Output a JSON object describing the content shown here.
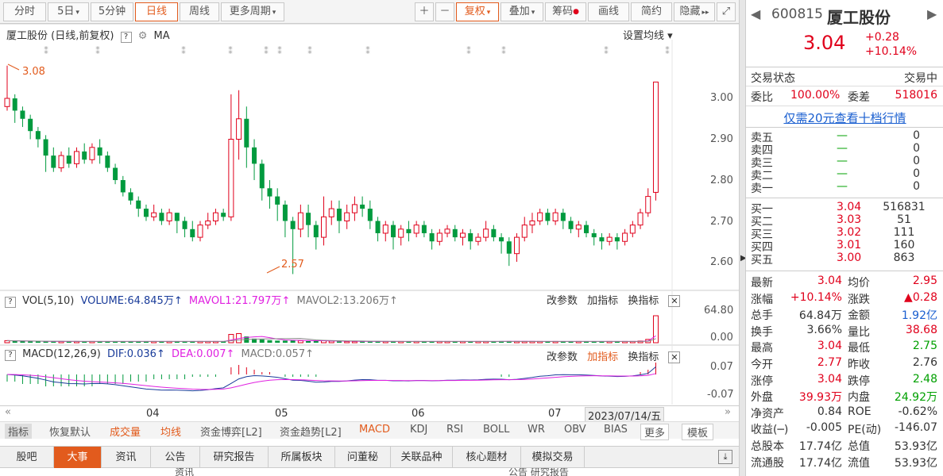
{
  "toolbar": {
    "buttons": [
      "分时",
      "5日",
      "5分钟",
      "日线",
      "周线",
      "更多周期"
    ],
    "active": "日线",
    "right_buttons": [
      "复权",
      "叠加",
      "筹码",
      "画线",
      "简约",
      "隐藏"
    ]
  },
  "chart": {
    "title": "厦工股份 (日线,前复权)",
    "ma_label": "MA",
    "set_ma": "设置均线",
    "high_label": "3.08",
    "low_label": "2.57",
    "y_ticks": [
      "3.00",
      "2.90",
      "2.80",
      "2.70",
      "2.60"
    ],
    "x_ticks": [
      "04",
      "05",
      "06",
      "07"
    ],
    "date_label": "2023/07/14/五"
  },
  "vol": {
    "label": "VOL(5,10)",
    "volume": "VOLUME:64.845万",
    "mavol1": "MAVOL1:21.797万",
    "mavol2": "MAVOL2:13.206万",
    "y_top": "64.80",
    "y_bottom": "0.00",
    "actions": [
      "改参数",
      "加指标",
      "换指标"
    ]
  },
  "macd": {
    "label": "MACD(12,26,9)",
    "dif": "DIF:0.036",
    "dea": "DEA:0.007",
    "macd": "MACD:0.057",
    "y_top": "0.07",
    "y_bottom": "-0.07",
    "actions": [
      "改参数",
      "加指标",
      "换指标"
    ]
  },
  "indicators": [
    "指标",
    "恢复默认",
    "成交量",
    "均线",
    "资金博弈[L2]",
    "资金趋势[L2]",
    "MACD",
    "KDJ",
    "RSI",
    "BOLL",
    "WR",
    "OBV",
    "BIAS",
    "更多",
    "模板"
  ],
  "tabs": [
    "股吧",
    "大事",
    "资讯",
    "公告",
    "研究报告",
    "所属板块",
    "问董秘",
    "关联品种",
    "核心题材",
    "模拟交易"
  ],
  "active_tab": "大事",
  "bottom_stub": {
    "left": "资讯",
    "right": "公告 研究报告"
  },
  "quote": {
    "code": "600815",
    "name": "厦工股份",
    "price": "3.04",
    "change": "+0.28",
    "pct": "+10.14%",
    "status_label": "交易状态",
    "status": "交易中",
    "weibi_label": "委比",
    "weibi": "100.00%",
    "weicha_label": "委差",
    "weicha": "518016",
    "promo": "仅需20元查看十档行情",
    "asks": [
      {
        "label": "卖五",
        "price": "—",
        "vol": "0"
      },
      {
        "label": "卖四",
        "price": "—",
        "vol": "0"
      },
      {
        "label": "卖三",
        "price": "—",
        "vol": "0"
      },
      {
        "label": "卖二",
        "price": "—",
        "vol": "0"
      },
      {
        "label": "卖一",
        "price": "—",
        "vol": "0"
      }
    ],
    "bids": [
      {
        "label": "买一",
        "price": "3.04",
        "vol": "516831"
      },
      {
        "label": "买二",
        "price": "3.03",
        "vol": "51"
      },
      {
        "label": "买三",
        "price": "3.02",
        "vol": "111"
      },
      {
        "label": "买四",
        "price": "3.01",
        "vol": "160"
      },
      {
        "label": "买五",
        "price": "3.00",
        "vol": "863"
      }
    ],
    "stats": [
      {
        "l1": "最新",
        "v1": "3.04",
        "c1": "red",
        "l2": "均价",
        "v2": "2.95",
        "c2": "red"
      },
      {
        "l1": "涨幅",
        "v1": "+10.14%",
        "c1": "red",
        "l2": "涨跌",
        "v2": "▲0.28",
        "c2": "red"
      },
      {
        "l1": "总手",
        "v1": "64.84万",
        "c1": "",
        "l2": "金额",
        "v2": "1.92亿",
        "c2": "blue"
      },
      {
        "l1": "换手",
        "v1": "3.66%",
        "c1": "",
        "l2": "量比",
        "v2": "38.68",
        "c2": "red"
      },
      {
        "l1": "最高",
        "v1": "3.04",
        "c1": "red",
        "l2": "最低",
        "v2": "2.75",
        "c2": "green"
      },
      {
        "l1": "今开",
        "v1": "2.77",
        "c1": "red",
        "l2": "昨收",
        "v2": "2.76",
        "c2": ""
      },
      {
        "l1": "涨停",
        "v1": "3.04",
        "c1": "red",
        "l2": "跌停",
        "v2": "2.48",
        "c2": "green"
      },
      {
        "l1": "外盘",
        "v1": "39.93万",
        "c1": "red",
        "l2": "内盘",
        "v2": "24.92万",
        "c2": "green"
      },
      {
        "l1": "净资产",
        "v1": "0.84",
        "c1": "",
        "l2": "ROE",
        "v2": "-0.62%",
        "c2": ""
      },
      {
        "l1": "收益(─)",
        "v1": "-0.005",
        "c1": "",
        "l2": "PE(动)",
        "v2": "-146.07",
        "c2": ""
      },
      {
        "l1": "总股本",
        "v1": "17.74亿",
        "c1": "",
        "l2": "总值",
        "v2": "53.93亿",
        "c2": ""
      },
      {
        "l1": "流通股",
        "v1": "17.74亿",
        "c1": "",
        "l2": "流值",
        "v2": "53.93亿",
        "c2": ""
      }
    ]
  },
  "colors": {
    "up": "#e0001b",
    "down": "#009a3e",
    "accent": "#e25b1d",
    "ma1": "#e020e0",
    "ma2": "#888888"
  },
  "candles": [
    [
      2.98,
      3.0,
      2.97,
      3.08
    ],
    [
      3.0,
      2.97,
      2.94,
      3.01
    ],
    [
      2.97,
      2.95,
      2.93,
      2.98
    ],
    [
      2.95,
      2.92,
      2.9,
      2.96
    ],
    [
      2.92,
      2.9,
      2.88,
      2.93
    ],
    [
      2.9,
      2.86,
      2.82,
      2.91
    ],
    [
      2.86,
      2.83,
      2.82,
      2.88
    ],
    [
      2.83,
      2.86,
      2.82,
      2.87
    ],
    [
      2.86,
      2.84,
      2.83,
      2.88
    ],
    [
      2.84,
      2.87,
      2.83,
      2.88
    ],
    [
      2.87,
      2.85,
      2.84,
      2.89
    ],
    [
      2.85,
      2.88,
      2.84,
      2.89
    ],
    [
      2.88,
      2.86,
      2.84,
      2.9
    ],
    [
      2.86,
      2.83,
      2.82,
      2.87
    ],
    [
      2.83,
      2.8,
      2.79,
      2.84
    ],
    [
      2.8,
      2.77,
      2.76,
      2.81
    ],
    [
      2.77,
      2.75,
      2.74,
      2.78
    ],
    [
      2.75,
      2.73,
      2.71,
      2.76
    ],
    [
      2.73,
      2.71,
      2.7,
      2.74
    ],
    [
      2.71,
      2.72,
      2.7,
      2.74
    ],
    [
      2.72,
      2.7,
      2.69,
      2.73
    ],
    [
      2.7,
      2.72,
      2.69,
      2.73
    ],
    [
      2.72,
      2.7,
      2.67,
      2.72
    ],
    [
      2.7,
      2.68,
      2.66,
      2.71
    ],
    [
      2.68,
      2.66,
      2.65,
      2.7
    ],
    [
      2.66,
      2.69,
      2.65,
      2.7
    ],
    [
      2.69,
      2.7,
      2.68,
      2.72
    ],
    [
      2.7,
      2.72,
      2.69,
      2.73
    ],
    [
      2.72,
      2.71,
      2.7,
      2.73
    ],
    [
      2.71,
      2.9,
      2.7,
      3.01
    ],
    [
      2.9,
      2.95,
      2.85,
      3.02
    ],
    [
      2.95,
      2.88,
      2.83,
      2.98
    ],
    [
      2.88,
      2.84,
      2.8,
      2.9
    ],
    [
      2.84,
      2.78,
      2.75,
      2.85
    ],
    [
      2.78,
      2.76,
      2.73,
      2.8
    ],
    [
      2.76,
      2.74,
      2.7,
      2.78
    ],
    [
      2.74,
      2.7,
      2.66,
      2.75
    ],
    [
      2.7,
      2.68,
      2.57,
      2.71
    ],
    [
      2.68,
      2.72,
      2.66,
      2.74
    ],
    [
      2.72,
      2.69,
      2.66,
      2.74
    ],
    [
      2.69,
      2.66,
      2.63,
      2.7
    ],
    [
      2.66,
      2.71,
      2.64,
      2.76
    ],
    [
      2.71,
      2.73,
      2.69,
      2.75
    ],
    [
      2.73,
      2.7,
      2.67,
      2.75
    ],
    [
      2.7,
      2.72,
      2.68,
      2.74
    ],
    [
      2.72,
      2.74,
      2.7,
      2.76
    ],
    [
      2.74,
      2.73,
      2.71,
      2.76
    ],
    [
      2.73,
      2.7,
      2.68,
      2.75
    ],
    [
      2.7,
      2.67,
      2.65,
      2.71
    ],
    [
      2.67,
      2.69,
      2.65,
      2.7
    ],
    [
      2.69,
      2.66,
      2.63,
      2.7
    ],
    [
      2.66,
      2.68,
      2.64,
      2.69
    ],
    [
      2.68,
      2.67,
      2.65,
      2.7
    ],
    [
      2.67,
      2.69,
      2.66,
      2.7
    ],
    [
      2.69,
      2.67,
      2.66,
      2.7
    ],
    [
      2.67,
      2.65,
      2.63,
      2.68
    ],
    [
      2.65,
      2.67,
      2.64,
      2.68
    ],
    [
      2.67,
      2.68,
      2.66,
      2.69
    ],
    [
      2.68,
      2.66,
      2.65,
      2.69
    ],
    [
      2.66,
      2.67,
      2.64,
      2.68
    ],
    [
      2.67,
      2.65,
      2.63,
      2.68
    ],
    [
      2.65,
      2.66,
      2.64,
      2.67
    ],
    [
      2.66,
      2.68,
      2.65,
      2.7
    ],
    [
      2.68,
      2.66,
      2.65,
      2.69
    ],
    [
      2.66,
      2.65,
      2.62,
      2.67
    ],
    [
      2.65,
      2.62,
      2.59,
      2.66
    ],
    [
      2.62,
      2.66,
      2.6,
      2.67
    ],
    [
      2.66,
      2.69,
      2.65,
      2.71
    ],
    [
      2.69,
      2.7,
      2.67,
      2.72
    ],
    [
      2.7,
      2.72,
      2.69,
      2.73
    ],
    [
      2.72,
      2.7,
      2.69,
      2.73
    ],
    [
      2.7,
      2.72,
      2.69,
      2.73
    ],
    [
      2.72,
      2.7,
      2.68,
      2.73
    ],
    [
      2.7,
      2.68,
      2.67,
      2.71
    ],
    [
      2.68,
      2.69,
      2.66,
      2.7
    ],
    [
      2.69,
      2.67,
      2.66,
      2.7
    ],
    [
      2.67,
      2.66,
      2.64,
      2.68
    ],
    [
      2.66,
      2.65,
      2.63,
      2.67
    ],
    [
      2.65,
      2.66,
      2.64,
      2.67
    ],
    [
      2.66,
      2.65,
      2.63,
      2.67
    ],
    [
      2.65,
      2.67,
      2.64,
      2.68
    ],
    [
      2.67,
      2.69,
      2.66,
      2.7
    ],
    [
      2.69,
      2.72,
      2.68,
      2.73
    ],
    [
      2.72,
      2.76,
      2.71,
      2.78
    ],
    [
      2.77,
      3.04,
      2.75,
      3.04
    ]
  ],
  "volumes": [
    5,
    4,
    4,
    3,
    3,
    3,
    3,
    3,
    3,
    3,
    3,
    3,
    3,
    3,
    3,
    3,
    3,
    3,
    3,
    3,
    3,
    3,
    3,
    3,
    3,
    3,
    3,
    3,
    3,
    20,
    22,
    15,
    10,
    8,
    6,
    5,
    5,
    6,
    5,
    4,
    4,
    5,
    4,
    3,
    3,
    3,
    3,
    3,
    3,
    3,
    3,
    3,
    3,
    3,
    3,
    3,
    3,
    3,
    3,
    3,
    3,
    3,
    3,
    3,
    4,
    4,
    3,
    3,
    3,
    3,
    3,
    3,
    3,
    3,
    3,
    3,
    3,
    3,
    3,
    3,
    3,
    3,
    4,
    8,
    65
  ],
  "macd_hist": [
    -0.03,
    -0.03,
    -0.04,
    -0.04,
    -0.04,
    -0.05,
    -0.05,
    -0.05,
    -0.05,
    -0.05,
    -0.05,
    -0.05,
    -0.04,
    -0.04,
    -0.04,
    -0.04,
    -0.03,
    -0.03,
    -0.03,
    -0.02,
    -0.02,
    -0.02,
    -0.02,
    -0.02,
    -0.01,
    -0.01,
    -0.01,
    -0.01,
    0.0,
    0.03,
    0.04,
    0.03,
    0.02,
    0.01,
    0.01,
    0.0,
    -0.01,
    -0.01,
    -0.01,
    -0.01,
    -0.01,
    0.0,
    0.0,
    0.0,
    0.0,
    0.0,
    0.0,
    0.0,
    0.0,
    0.0,
    0.0,
    0.0,
    0.0,
    0.0,
    0.0,
    0.0,
    0.0,
    0.0,
    0.0,
    0.0,
    0.0,
    0.0,
    0.0,
    0.0,
    -0.01,
    -0.01,
    0.0,
    0.0,
    0.0,
    0.0,
    0.0,
    0.0,
    0.0,
    0.0,
    0.0,
    0.0,
    0.0,
    0.0,
    0.0,
    0.0,
    0.0,
    0.0,
    0.01,
    0.02,
    0.05
  ]
}
